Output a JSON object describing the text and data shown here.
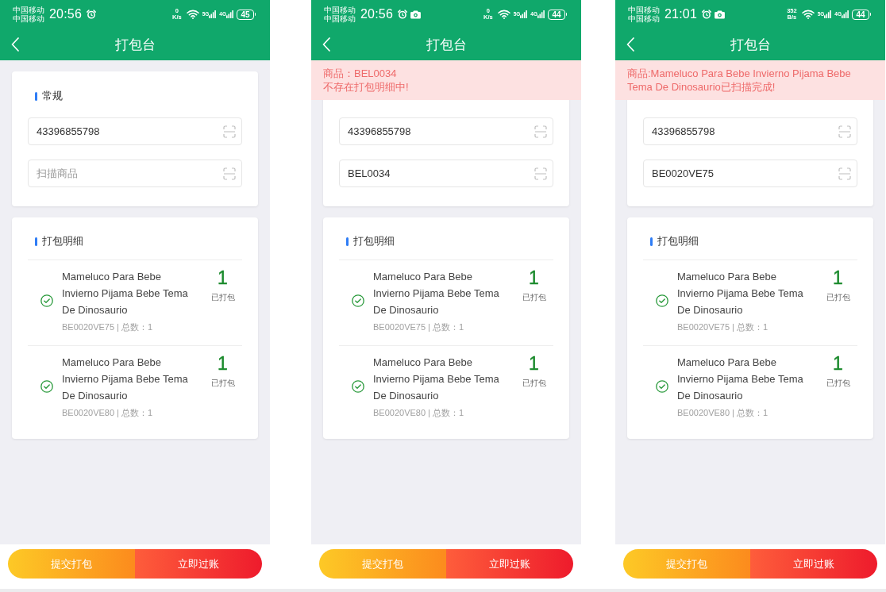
{
  "screens": [
    {
      "status_bar": {
        "carriers": [
          "中国移动",
          "中国移动"
        ],
        "time": "20:56",
        "notification_icons": [
          {
            "kind": "alarm"
          }
        ],
        "net_speed": {
          "value": "0",
          "unit": "K/s"
        },
        "signals": [
          {
            "label": "5G"
          },
          {
            "label": "4G"
          }
        ],
        "battery": "45"
      },
      "header": {
        "title": "打包台"
      },
      "general": {
        "title": "常规",
        "fields": [
          {
            "value": "43396855798"
          },
          {
            "placeholder": "扫描商品"
          }
        ]
      },
      "detail": {
        "title": "打包明细",
        "items": [
          {
            "name": "Mameluco Para Bebe Invierno Pijama Bebe Tema De Dinosaurio",
            "meta": "BE0020VE75 | 总数：1",
            "count": "1",
            "count_label": "已打包",
            "checked": true
          },
          {
            "name": "Mameluco Para Bebe Invierno Pijama Bebe Tema De Dinosaurio",
            "meta": "BE0020VE80 | 总数：1",
            "count": "1",
            "count_label": "已打包",
            "checked": true
          }
        ]
      },
      "actions": [
        {
          "kind": "submit",
          "label": "提交打包"
        },
        {
          "kind": "post",
          "label": "立即过账"
        }
      ]
    },
    {
      "status_bar": {
        "carriers": [
          "中国移动",
          "中国移动"
        ],
        "time": "20:56",
        "notification_icons": [
          {
            "kind": "alarm"
          },
          {
            "kind": "camera"
          }
        ],
        "net_speed": {
          "value": "0",
          "unit": "K/s"
        },
        "signals": [
          {
            "label": "5G"
          },
          {
            "label": "4G"
          }
        ],
        "battery": "44"
      },
      "header": {
        "title": "打包台"
      },
      "toast": {
        "lines": [
          "商品：BEL0034",
          "不存在打包明细中!"
        ]
      },
      "general": {
        "fields": [
          {
            "value": "43396855798"
          },
          {
            "value": "BEL0034"
          }
        ]
      },
      "detail": {
        "title": "打包明细",
        "items": [
          {
            "name": "Mameluco Para Bebe Invierno Pijama Bebe Tema De Dinosaurio",
            "meta": "BE0020VE75 | 总数：1",
            "count": "1",
            "count_label": "已打包",
            "checked": true
          },
          {
            "name": "Mameluco Para Bebe Invierno Pijama Bebe Tema De Dinosaurio",
            "meta": "BE0020VE80 | 总数：1",
            "count": "1",
            "count_label": "已打包",
            "checked": true
          }
        ]
      },
      "actions": [
        {
          "kind": "submit",
          "label": "提交打包"
        },
        {
          "kind": "post",
          "label": "立即过账"
        }
      ]
    },
    {
      "status_bar": {
        "carriers": [
          "中国移动",
          "中国移动"
        ],
        "time": "21:01",
        "notification_icons": [
          {
            "kind": "alarm"
          },
          {
            "kind": "camera"
          }
        ],
        "net_speed": {
          "value": "352",
          "unit": "B/s"
        },
        "signals": [
          {
            "label": "5G"
          },
          {
            "label": "4G"
          }
        ],
        "battery": "44"
      },
      "header": {
        "title": "打包台"
      },
      "toast": {
        "lines": [
          "商品:Mameluco Para Bebe Invierno Pijama Bebe Tema De Dinosaurio已扫描完成!"
        ]
      },
      "general": {
        "fields": [
          {
            "value": "43396855798"
          },
          {
            "value": "BE0020VE75"
          }
        ]
      },
      "detail": {
        "title": "打包明细",
        "items": [
          {
            "name": "Mameluco Para Bebe Invierno Pijama Bebe Tema De Dinosaurio",
            "meta": "BE0020VE75 | 总数：1",
            "count": "1",
            "count_label": "已打包",
            "checked": true
          },
          {
            "name": "Mameluco Para Bebe Invierno Pijama Bebe Tema De Dinosaurio",
            "meta": "BE0020VE80 | 总数：1",
            "count": "1",
            "count_label": "已打包",
            "checked": true
          }
        ]
      },
      "actions": [
        {
          "kind": "submit",
          "label": "提交打包"
        },
        {
          "kind": "post",
          "label": "立即过账"
        }
      ]
    }
  ]
}
